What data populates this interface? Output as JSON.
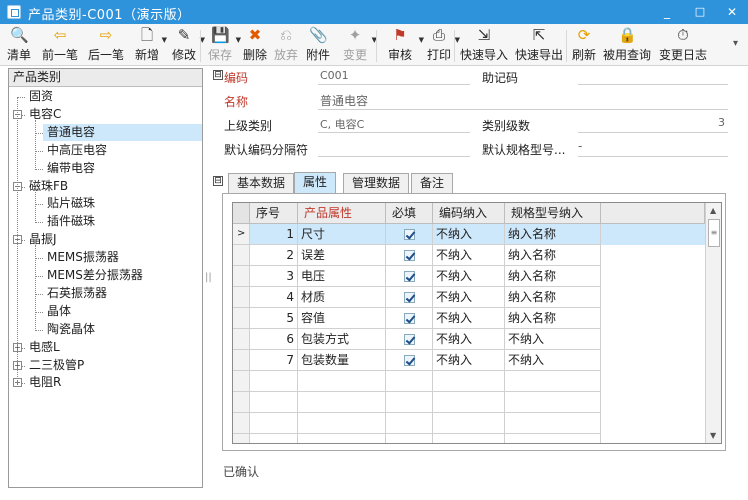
{
  "window": {
    "title": "产品类别-C001（演示版）",
    "minimize": "_",
    "maximize": "□",
    "close": "✕"
  },
  "toolbar": {
    "buttons": [
      {
        "label": "清单",
        "icon": "list-search-icon",
        "glyph": "🔍",
        "color": "#333333"
      },
      {
        "label": "前一笔",
        "icon": "arrow-left-icon",
        "glyph": "⇦",
        "color": "#e6a000"
      },
      {
        "label": "后一笔",
        "icon": "arrow-right-icon",
        "glyph": "⇨",
        "color": "#e6a000"
      },
      {
        "label": "新增",
        "icon": "new-doc-icon",
        "glyph": "🗋",
        "color": "#333333"
      },
      {
        "label": "修改",
        "icon": "edit-icon",
        "glyph": "✎",
        "color": "#333333"
      },
      {
        "label": "保存",
        "icon": "save-icon",
        "glyph": "💾",
        "color": "#a0a0a0"
      },
      {
        "label": "删除",
        "icon": "delete-icon",
        "glyph": "✖",
        "color": "#e05a00"
      },
      {
        "label": "放弃",
        "icon": "discard-icon",
        "glyph": "⎌",
        "color": "#a0a0a0"
      },
      {
        "label": "附件",
        "icon": "attachment-icon",
        "glyph": "📎",
        "color": "#333333"
      },
      {
        "label": "变更",
        "icon": "change-icon",
        "glyph": "✦",
        "color": "#a0a0a0"
      },
      {
        "label": "审核",
        "icon": "audit-icon",
        "glyph": "⚑",
        "color": "#c0392b"
      },
      {
        "label": "打印",
        "icon": "print-icon",
        "glyph": "⎙",
        "color": "#333333"
      },
      {
        "label": "快速导入",
        "icon": "quick-import-icon",
        "glyph": "⇲",
        "color": "#333333"
      },
      {
        "label": "快速导出",
        "icon": "quick-export-icon",
        "glyph": "⇱",
        "color": "#333333"
      },
      {
        "label": "刷新",
        "icon": "refresh-icon",
        "glyph": "⟳",
        "color": "#e6a000"
      },
      {
        "label": "被用查询",
        "icon": "usage-query-icon",
        "glyph": "🔒",
        "color": "#e6a000"
      },
      {
        "label": "变更日志",
        "icon": "change-log-icon",
        "glyph": "⏱",
        "color": "#333333"
      }
    ]
  },
  "tree": {
    "header": "产品类别",
    "nodes": [
      {
        "label": "固资"
      },
      {
        "label": "电容C",
        "toggle": "⊟"
      },
      {
        "label": "普通电容"
      },
      {
        "label": "中高压电容"
      },
      {
        "label": "编带电容"
      },
      {
        "label": "磁珠FB",
        "toggle": "⊟"
      },
      {
        "label": "贴片磁珠"
      },
      {
        "label": "插件磁珠"
      },
      {
        "label": "晶振J",
        "toggle": "⊟"
      },
      {
        "label": "MEMS振荡器"
      },
      {
        "label": "MEMS差分振荡器"
      },
      {
        "label": "石英振荡器"
      },
      {
        "label": "晶体"
      },
      {
        "label": "陶瓷晶体"
      },
      {
        "label": "电感L",
        "toggle": "⊞"
      },
      {
        "label": "二三极管P",
        "toggle": "⊞"
      },
      {
        "label": "电阻R",
        "toggle": "⊞"
      }
    ]
  },
  "form": {
    "section_toggle": "⊟",
    "code_label": "编码",
    "code_value": "C001",
    "mnemonic_label": "助记码",
    "mnemonic_value": "",
    "name_label": "名称",
    "name_value": "普通电容",
    "parent_label": "上级类别",
    "parent_value": "C, 电容C",
    "level_label": "类别级数",
    "level_value": "3",
    "sep_label": "默认编码分隔符",
    "sep_value": "",
    "spec_label": "默认规格型号...",
    "spec_value": "-"
  },
  "tabs": {
    "toggle": "⊟",
    "items": [
      "基本数据",
      "属性",
      "管理数据",
      "备注"
    ],
    "active_index": 1
  },
  "grid": {
    "columns": [
      "序号",
      "产品属性",
      "必填",
      "编码纳入",
      "规格型号纳入"
    ],
    "rows": [
      {
        "no": "1",
        "attr": "尺寸",
        "required": true,
        "code_incl": "不纳入",
        "spec_incl": "纳入名称"
      },
      {
        "no": "2",
        "attr": "误差",
        "required": true,
        "code_incl": "不纳入",
        "spec_incl": "纳入名称"
      },
      {
        "no": "3",
        "attr": "电压",
        "required": true,
        "code_incl": "不纳入",
        "spec_incl": "纳入名称"
      },
      {
        "no": "4",
        "attr": "材质",
        "required": true,
        "code_incl": "不纳入",
        "spec_incl": "纳入名称"
      },
      {
        "no": "5",
        "attr": "容值",
        "required": true,
        "code_incl": "不纳入",
        "spec_incl": "纳入名称"
      },
      {
        "no": "6",
        "attr": "包装方式",
        "required": true,
        "code_incl": "不纳入",
        "spec_incl": "不纳入"
      },
      {
        "no": "7",
        "attr": "包装数量",
        "required": true,
        "code_incl": "不纳入",
        "spec_incl": "不纳入"
      }
    ],
    "current_row_marker": ">",
    "empty_rows": 4
  },
  "status": {
    "text": "已确认"
  },
  "colors": {
    "titlebar": "#2f93dc",
    "selection": "#cde8fb",
    "required_label": "#c0392b"
  }
}
